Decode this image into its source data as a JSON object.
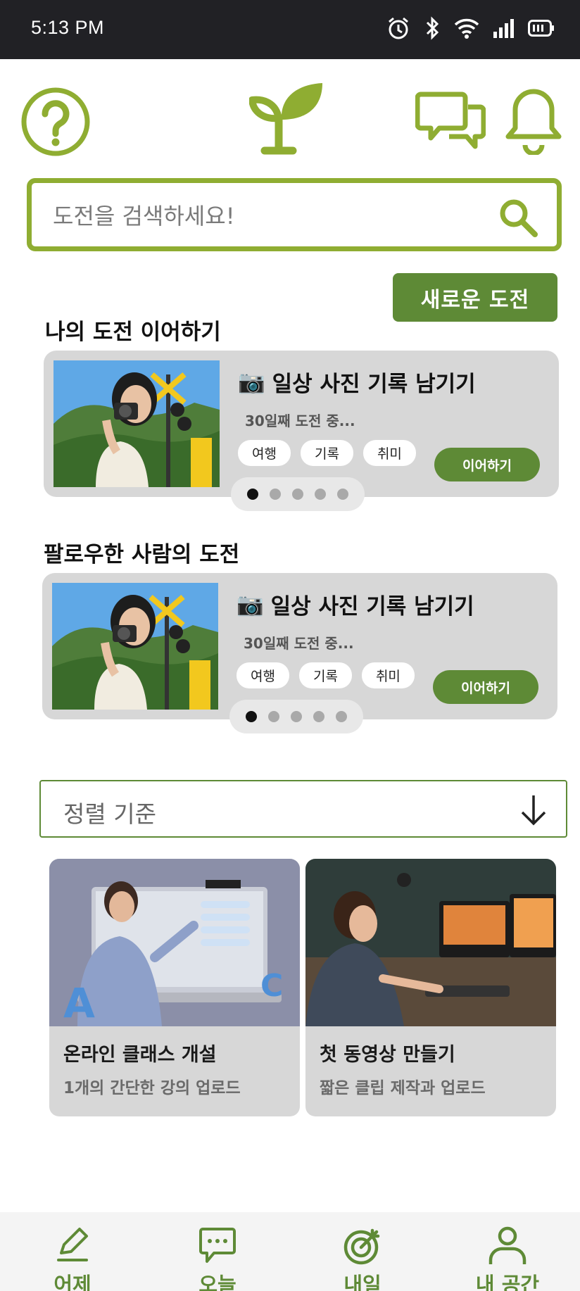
{
  "status_bar": {
    "time": "5:13 PM",
    "icons": [
      "alarm-icon",
      "bluetooth-icon",
      "wifi-icon",
      "signal-icon",
      "battery-icon"
    ]
  },
  "header": {
    "icons": [
      "help-icon",
      "sprout-logo-icon",
      "chat-icon",
      "bell-icon"
    ],
    "accent_color": "#8fad32"
  },
  "search": {
    "placeholder": "도전을 검색하세요!"
  },
  "new_challenge_button": "새로운 도전",
  "my_section": {
    "title": "나의 도전 이어하기",
    "card": {
      "emoji": "📷",
      "title": "일상 사진 기록 남기기",
      "subtitle": "30일째 도전 중...",
      "tags": [
        "여행",
        "기록",
        "취미"
      ],
      "button": "이어하기",
      "page_count": 5,
      "active_page": 1
    }
  },
  "follow_section": {
    "title": "팔로우한 사람의 도전",
    "card": {
      "emoji": "📷",
      "title": "일상 사진 기록 남기기",
      "subtitle": "30일째 도전 중...",
      "tags": [
        "여행",
        "기록",
        "취미"
      ],
      "button": "이어하기",
      "page_count": 5,
      "active_page": 1
    }
  },
  "sort": {
    "label": "정렬 기준"
  },
  "grid": [
    {
      "title": "온라인 클래스 개설",
      "subtitle": "1개의 간단한 강의 업로드"
    },
    {
      "title": "첫 동영상 만들기",
      "subtitle": "짧은 클립 제작과 업로드"
    }
  ],
  "bottom_nav": [
    {
      "label": "어제",
      "icon": "pencil-icon"
    },
    {
      "label": "오늘",
      "icon": "chat-bubble-icon"
    },
    {
      "label": "내일",
      "icon": "target-icon"
    },
    {
      "label": "내 공간",
      "icon": "person-icon"
    }
  ],
  "brand_color": "#5e8a36"
}
